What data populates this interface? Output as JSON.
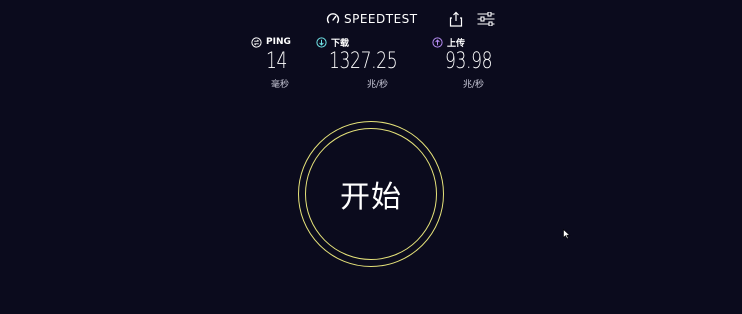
{
  "header": {
    "brand_text": "SPEEDTEST",
    "brand_icon": "speedometer-icon",
    "share_icon": "share-icon",
    "settings_icon": "sliders-icon"
  },
  "metrics": {
    "ping": {
      "label": "PING",
      "value": "14",
      "unit": "毫秒",
      "icon": "ping-icon",
      "color": "#ffffff"
    },
    "download": {
      "label": "下载",
      "value": "1327.25",
      "unit": "兆/秒",
      "icon": "download-arrow-icon",
      "color": "#6fe3e6"
    },
    "upload": {
      "label": "上传",
      "value": "93.98",
      "unit": "兆/秒",
      "icon": "upload-arrow-icon",
      "color": "#b58cf2"
    }
  },
  "start_button": {
    "label": "开始",
    "ring_color": "#e6e37a"
  },
  "colors": {
    "background": "#0b0b1d",
    "accent_ring": "#e6e37a"
  }
}
